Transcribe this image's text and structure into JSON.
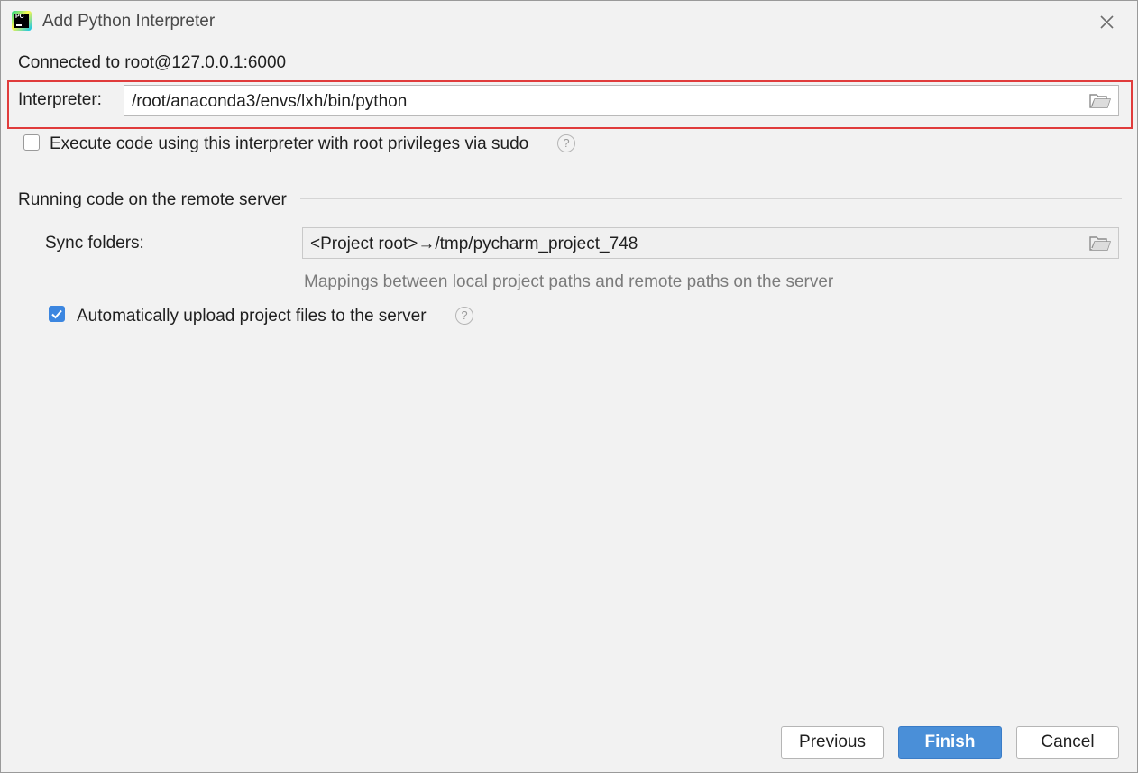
{
  "window": {
    "title": "Add Python Interpreter",
    "app_icon_text": "PC"
  },
  "connection": {
    "text": "Connected to root@127.0.0.1:6000"
  },
  "interpreter": {
    "label": "Interpreter:",
    "value": "/root/anaconda3/envs/lxh/bin/python"
  },
  "sudo": {
    "label": "Execute code using this interpreter with root privileges via sudo",
    "checked": false
  },
  "remote": {
    "section_title": "Running code on the remote server",
    "sync_label": "Sync folders:",
    "sync_value": "<Project root>→/tmp/pycharm_project_748",
    "sync_hint": "Mappings between local project paths and remote paths on the server",
    "upload_label": "Automatically upload project files to the server",
    "upload_checked": true
  },
  "help_glyph": "?",
  "buttons": {
    "previous": "Previous",
    "finish": "Finish",
    "cancel": "Cancel"
  },
  "colors": {
    "highlight": "#e03c3c",
    "accent": "#4a8fd8",
    "checkbox_checked": "#3c86e0"
  }
}
